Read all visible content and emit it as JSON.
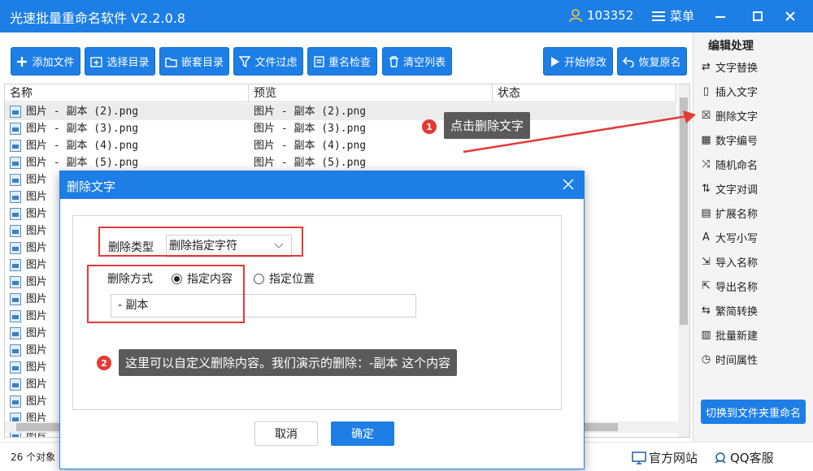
{
  "app": {
    "title": "光速批量重命名软件 V2.2.0.8",
    "user_id": "103352",
    "menu_label": "菜单"
  },
  "toolbar": {
    "add_file": "添加文件",
    "select_dir": "选择目录",
    "nested_dir": "嵌套目录",
    "file_filter": "文件过虑",
    "rename_check": "重名检查",
    "clear_list": "清空列表",
    "start_modify": "开始修改",
    "restore_name": "恢复原名"
  },
  "right_panel": {
    "title": "编辑处理",
    "items": [
      {
        "label": "文字替换",
        "icon": "swap-arrows-icon"
      },
      {
        "label": "插入文字",
        "icon": "insert-doc-icon"
      },
      {
        "label": "删除文字",
        "icon": "delete-doc-icon"
      },
      {
        "label": "数字编号",
        "icon": "number-icon"
      },
      {
        "label": "随机命名",
        "icon": "shuffle-icon"
      },
      {
        "label": "文字对调",
        "icon": "exchange-icon"
      },
      {
        "label": "扩展名称",
        "icon": "extension-icon"
      },
      {
        "label": "大写小写",
        "icon": "case-icon"
      },
      {
        "label": "导入名称",
        "icon": "import-icon"
      },
      {
        "label": "导出名称",
        "icon": "export-icon"
      },
      {
        "label": "繁简转换",
        "icon": "convert-icon"
      },
      {
        "label": "批量新建",
        "icon": "new-doc-icon"
      },
      {
        "label": "时间属性",
        "icon": "clock-icon"
      }
    ],
    "switch_button": "切换到文件夹重命名"
  },
  "table": {
    "columns": [
      "名称",
      "预览",
      "状态"
    ],
    "rows": [
      {
        "name": "图片 - 副本 (2).png",
        "preview": "图片 - 副本 (2).png"
      },
      {
        "name": "图片 - 副本 (3).png",
        "preview": "图片 - 副本 (3).png"
      },
      {
        "name": "图片 - 副本 (4).png",
        "preview": "图片 - 副本 (4).png"
      },
      {
        "name": "图片 - 副本 (5).png",
        "preview": "图片 - 副本 (5).png"
      },
      {
        "name": "图片",
        "preview": ""
      },
      {
        "name": "图片",
        "preview": ""
      },
      {
        "name": "图片",
        "preview": ""
      },
      {
        "name": "图片",
        "preview": ""
      },
      {
        "name": "图片",
        "preview": ""
      },
      {
        "name": "图片",
        "preview": ""
      },
      {
        "name": "图片",
        "preview": ""
      },
      {
        "name": "图片",
        "preview": ""
      },
      {
        "name": "图片",
        "preview": ""
      },
      {
        "name": "图片",
        "preview": ""
      },
      {
        "name": "图片",
        "preview": ""
      },
      {
        "name": "图片",
        "preview": ""
      },
      {
        "name": "图片",
        "preview": ""
      },
      {
        "name": "图片",
        "preview": ""
      },
      {
        "name": "图片",
        "preview": ""
      },
      {
        "name": "图片",
        "preview": ""
      }
    ]
  },
  "status": {
    "count": "26 个对象",
    "website": "官方网站",
    "qq": "QQ客服"
  },
  "annotations": {
    "step1_badge": "1",
    "step1_text": "点击删除文字",
    "step2_badge": "2",
    "step2_text": "这里可以自定义删除内容。我们演示的删除：-副本  这个内容"
  },
  "dialog": {
    "title": "删除文字",
    "delete_type_label": "删除类型",
    "delete_type_value": "删除指定字符",
    "delete_mode_label": "删除方式",
    "mode_content": "指定内容",
    "mode_position": "指定位置",
    "input_value": "- 副本",
    "cancel": "取消",
    "ok": "确定"
  },
  "colors": {
    "primary": "#1d7ee6",
    "highlight_red": "#e53935",
    "callout_bg": "#5a5a5a"
  }
}
